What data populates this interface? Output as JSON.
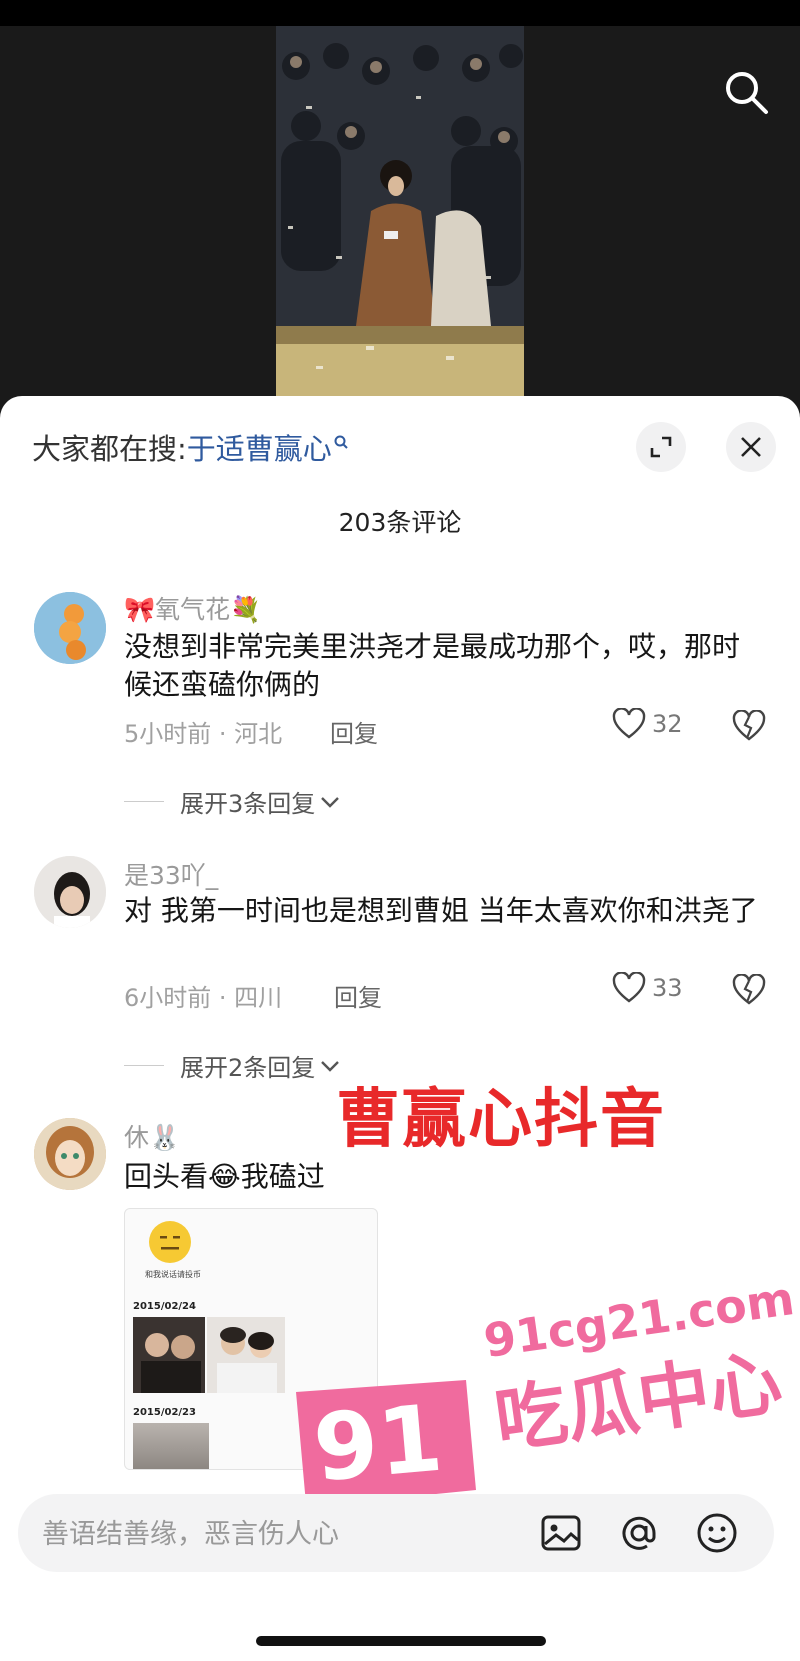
{
  "hot_search": {
    "prefix": "大家都在搜:",
    "keyword": "于适曹赢心"
  },
  "comment_count": "203条评论",
  "comments": [
    {
      "user_prefix": "🎀",
      "user": "氧气花",
      "user_suffix": "💐",
      "text": "没想到非常完美里洪尧才是最成功那个，哎，那时候还蛮磕你俩的",
      "meta": "5小时前 · 河北",
      "reply": "回复",
      "likes": "32"
    },
    {
      "user": "是33吖_",
      "text": "对 我第一时间也是想到曹姐 当年太喜欢你和洪尧了",
      "meta": "6小时前 · 四川",
      "reply": "回复",
      "likes": "33"
    },
    {
      "user": "休🐰",
      "text_before": "回头看",
      "text_emoji": "😂",
      "text_after": "我磕过"
    }
  ],
  "expand_replies": [
    "展开3条回复",
    "展开2条回复"
  ],
  "attached_screenshot": {
    "caption": "和我说话请投币",
    "date1": "2015/02/24",
    "date2": "2015/02/23"
  },
  "watermarks": {
    "red_text": "曹赢心抖音",
    "badge": "91",
    "site": "91cg21.com",
    "name": "吃瓜中心"
  },
  "input": {
    "placeholder": "善语结善缘，恶言伤人心"
  },
  "icons": {
    "search": "search-icon",
    "expand": "expand-icon",
    "close": "close-icon",
    "like": "heart-icon",
    "dislike": "broken-heart-icon",
    "image": "image-icon",
    "mention": "at-icon",
    "emoji": "emoji-icon"
  },
  "colors": {
    "link_blue": "#2f5a9e",
    "watermark_red": "#e8292a",
    "watermark_pink": "#f06b9e"
  }
}
